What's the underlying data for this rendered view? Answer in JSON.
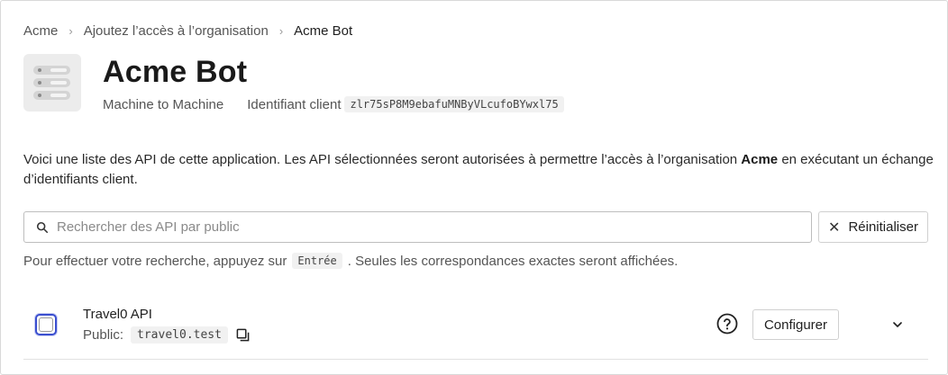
{
  "breadcrumb": {
    "items": [
      "Acme",
      "Ajoutez l’accès à l’organisation"
    ],
    "current": "Acme Bot",
    "separator": "›"
  },
  "app": {
    "icon": "server-stack-icon",
    "title": "Acme Bot",
    "type": "Machine to Machine",
    "client_id_label": "Identifiant client",
    "client_id": "zlr75sP8M9ebafuMNByVLcufoBYwxl75"
  },
  "description": {
    "before": "Voici une liste des API de cette application. Les API sélectionnées seront autorisées à permettre l’accès à l’organisation ",
    "org": "Acme",
    "after": " en exécutant un échange d’identifiants client."
  },
  "search": {
    "placeholder": "Rechercher des API par public",
    "value": "",
    "icon": "search-icon"
  },
  "reset_button": {
    "label": "Réinitialiser",
    "icon": "close-icon"
  },
  "hint": {
    "before": "Pour effectuer votre recherche, appuyez sur",
    "key": "Entrée",
    "after": ". Seules les correspondances exactes seront affichées."
  },
  "apis": [
    {
      "name": "Travel0 API",
      "audience_label": "Public:",
      "audience": "travel0.test",
      "checked": false,
      "configure_label": "Configurer"
    }
  ],
  "colors": {
    "accent": "#3b4fcf",
    "border": "#d0d0d0",
    "muted_text": "#555555"
  }
}
